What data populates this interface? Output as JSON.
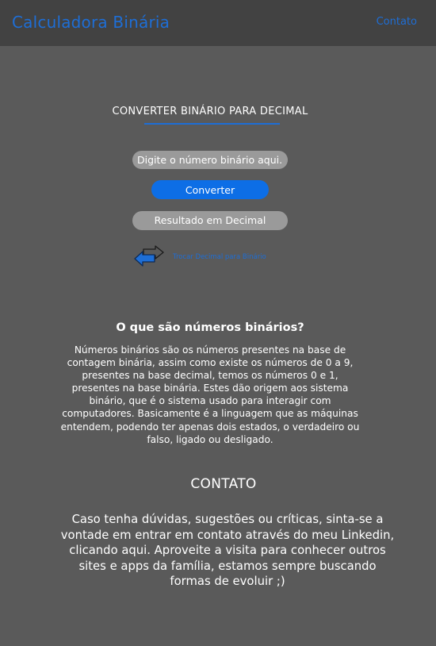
{
  "header": {
    "brand": "Calculadora Binária",
    "nav_contact": "Contato"
  },
  "converter": {
    "title": "CONVERTER BINÁRIO PARA DECIMAL",
    "input_placeholder": "Digite o número binário aqui...",
    "button_label": "Converter",
    "result_placeholder": "Resultado em Decimal",
    "swap_icon": "swap-arrows-icon",
    "swap_label": "Trocar Decimal para Binário"
  },
  "about": {
    "heading": "O que são números binários?",
    "text": "Números binários são os números presentes na base de contagem binária, assim como existe os números de 0 a 9, presentes na base decimal, temos os números 0 e 1, presentes na base binária. Estes dão origem aos sistema binário, que é o sistema usado para interagir com computadores. Basicamente é a linguagem que as máquinas entendem, podendo ter apenas dois estados, o verdadeiro ou falso, ligado ou desligado."
  },
  "contact": {
    "heading": "CONTATO",
    "text": "Caso tenha dúvidas, sugestões ou críticas, sinta-se a vontade em entrar em contato através do meu Linkedin, clicando aqui. Aproveite a visita para conhecer outros sites e apps da família, estamos sempre buscando formas de evoluir ;)"
  },
  "colors": {
    "background": "#5a5a5a",
    "header": "#424242",
    "accent": "#1e6ed6",
    "field": "#9a9a9a"
  }
}
